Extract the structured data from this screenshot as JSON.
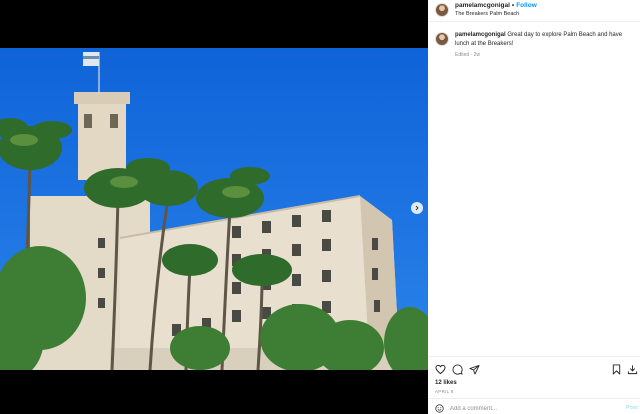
{
  "post": {
    "username": "pamelamcgonigal",
    "follow_label": "Follow",
    "location": "The Breakers Palm Beach",
    "caption_text": "Great day to explore Palm Beach and have lunch at the Breakers!",
    "caption_meta": "Edited · 2w",
    "likes": "12 likes",
    "date": "APRIL 8"
  },
  "comment": {
    "placeholder": "Add a comment...",
    "post_label": "Post"
  },
  "icons": {
    "like": "heart-icon",
    "comment": "comment-icon",
    "share": "paper-plane-icon",
    "save": "bookmark-icon",
    "download": "download-icon",
    "emoji": "emoji-icon",
    "next": "chevron-right-icon"
  },
  "colors": {
    "sky": "#1a6fd8",
    "follow": "#0095f6",
    "building": "#e6ddcd"
  }
}
